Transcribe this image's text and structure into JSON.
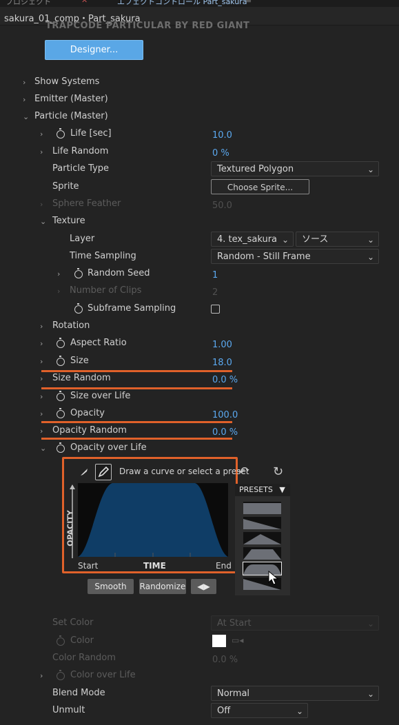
{
  "topbar": {
    "tab1": "プロジェクト",
    "tab2": "エフェクトコントロール Part_sakura"
  },
  "comp": {
    "breadcrumb": "sakura_01_comp・Part_sakura"
  },
  "plugin": {
    "title_cut": "TRAPCODE PARTICULAR BY RED GIANT",
    "designer_label": "Designer..."
  },
  "colors": {
    "accent": "#5ba9f0",
    "highlight": "#e0612a",
    "curve_fill": "#0f3d66",
    "button_blue": "#5aa7e6"
  },
  "params": {
    "show_systems": "Show Systems",
    "emitter": "Emitter (Master)",
    "particle": "Particle (Master)",
    "life": {
      "label": "Life [sec]",
      "value": "10.0"
    },
    "life_random": {
      "label": "Life Random",
      "value": "0 %"
    },
    "particle_type": {
      "label": "Particle Type",
      "value": "Textured Polygon"
    },
    "sprite": {
      "label": "Sprite",
      "button": "Choose Sprite..."
    },
    "sphere_feather": {
      "label": "Sphere Feather",
      "value": "50.0"
    },
    "texture": {
      "label": "Texture"
    },
    "layer": {
      "label": "Layer",
      "value": "4. tex_sakura",
      "source": "ソース"
    },
    "time_sampling": {
      "label": "Time Sampling",
      "value": "Random - Still Frame"
    },
    "random_seed": {
      "label": "Random Seed",
      "value": "1"
    },
    "number_of_clips": {
      "label": "Number of Clips",
      "value": "2"
    },
    "subframe_sampling": {
      "label": "Subframe Sampling",
      "checked": false
    },
    "rotation": {
      "label": "Rotation"
    },
    "aspect_ratio": {
      "label": "Aspect Ratio",
      "value": "1.00"
    },
    "size": {
      "label": "Size",
      "value": "18.0"
    },
    "size_random": {
      "label": "Size Random",
      "value": "0.0 %"
    },
    "size_over_life": {
      "label": "Size over Life"
    },
    "opacity": {
      "label": "Opacity",
      "value": "100.0"
    },
    "opacity_random": {
      "label": "Opacity Random",
      "value": "0.0 %"
    },
    "opacity_over_life": {
      "label": "Opacity over Life"
    },
    "set_color": {
      "label": "Set Color",
      "value": "At Start"
    },
    "color": {
      "label": "Color",
      "swatch": "#ffffff"
    },
    "color_random": {
      "label": "Color Random",
      "value": "0.0 %"
    },
    "color_over_life": {
      "label": "Color over Life"
    },
    "blend_mode": {
      "label": "Blend Mode",
      "value": "Normal"
    },
    "unmult": {
      "label": "Unmult",
      "value": "Off"
    }
  },
  "graph": {
    "hint": "Draw a curve or select a preset",
    "y_label": "OPACITY",
    "x_label": "TIME",
    "start": "Start",
    "end": "End",
    "smooth": "Smooth",
    "randomize": "Randomize",
    "presets": "PRESETS"
  }
}
